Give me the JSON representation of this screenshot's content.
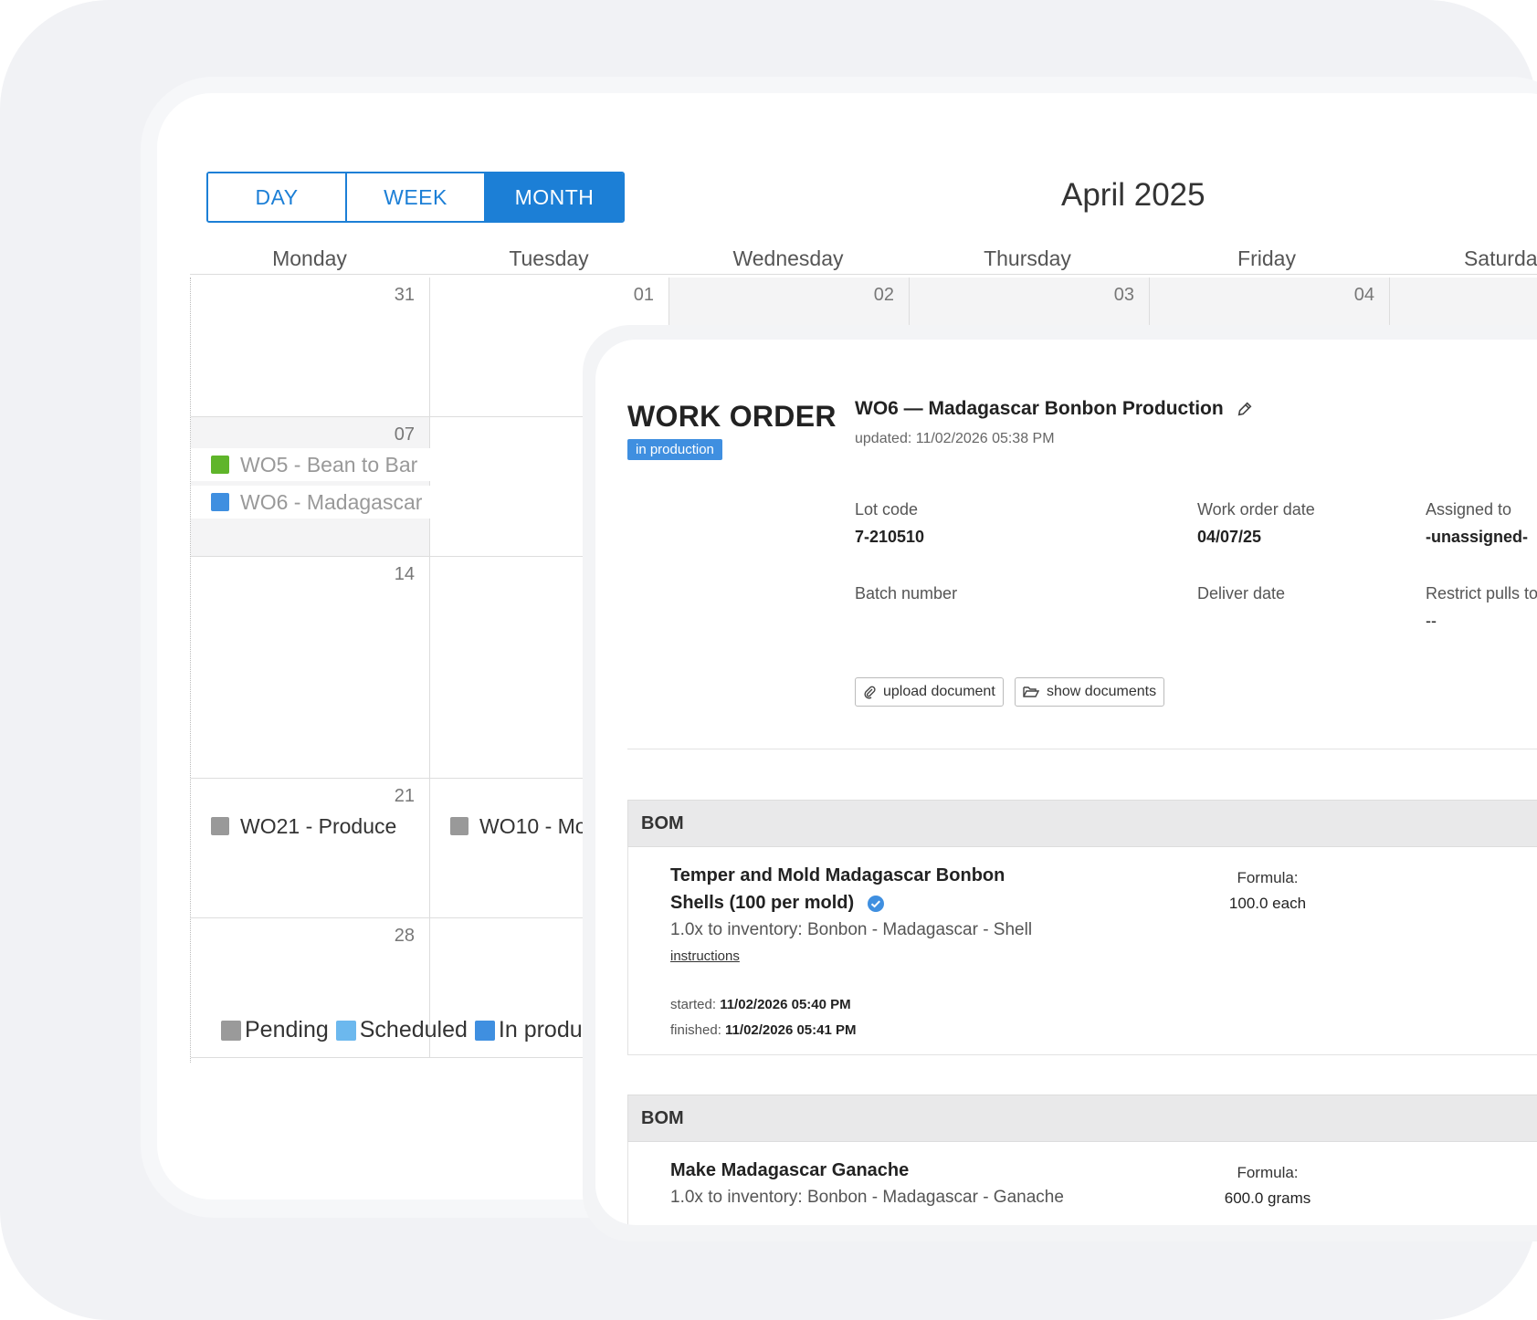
{
  "calendar": {
    "views": [
      "DAY",
      "WEEK",
      "MONTH"
    ],
    "active_view": "MONTH",
    "title": "April 2025",
    "weekdays": [
      "Monday",
      "Tuesday",
      "Wednesday",
      "Thursday",
      "Friday",
      "Saturday"
    ],
    "weeks": [
      {
        "days": [
          "31",
          "01",
          "02",
          "03",
          "04"
        ]
      },
      {
        "days": [
          "07"
        ]
      },
      {
        "days": [
          "14"
        ]
      },
      {
        "days": [
          "21"
        ]
      },
      {
        "days": [
          "28"
        ]
      }
    ],
    "events": [
      {
        "label": "WO5 - Bean to Bar",
        "color": "#5fb52a"
      },
      {
        "label": "WO6 - Madagascar",
        "color": "#3f8fe0"
      },
      {
        "label": "WO21 - Produce",
        "color": "#999999"
      },
      {
        "label": "WO10 - Mo",
        "color": "#999999"
      }
    ],
    "legend": [
      {
        "label": "Pending",
        "color": "#9a9a9a"
      },
      {
        "label": "Scheduled",
        "color": "#6cb8ee"
      },
      {
        "label": "In produ",
        "color": "#3f8fe0"
      }
    ]
  },
  "work_order": {
    "heading": "WORK ORDER",
    "status": "in production",
    "name": "WO6 — Madagascar Bonbon Production",
    "updated": "updated: 11/02/2026 05:38 PM",
    "fields": {
      "lot_code_label": "Lot code",
      "lot_code_value": "7-210510",
      "work_order_date_label": "Work order date",
      "work_order_date_value": "04/07/25",
      "assigned_label": "Assigned to",
      "assigned_value": "-unassigned-",
      "batch_label": "Batch number",
      "deliver_label": "Deliver date",
      "restrict_label": "Restrict pulls to",
      "restrict_value": "--"
    },
    "upload_label": "upload document",
    "show_label": "show documents",
    "boms": [
      {
        "header": "BOM",
        "title": "Temper and Mold Madagascar Bonbon Shells (100 per mold)",
        "inventory": "1.0x to inventory: Bonbon - Madagascar - Shell",
        "link": "instructions",
        "started_label": "started:",
        "started_value": "11/02/2026 05:40 PM",
        "finished_label": "finished:",
        "finished_value": "11/02/2026 05:41 PM",
        "formula_label": "Formula:",
        "formula_value": "100.0 each"
      },
      {
        "header": "BOM",
        "title": "Make Madagascar Ganache",
        "inventory": "1.0x to inventory: Bonbon - Madagascar - Ganache",
        "formula_label": "Formula:",
        "formula_value": "600.0 grams"
      }
    ]
  }
}
